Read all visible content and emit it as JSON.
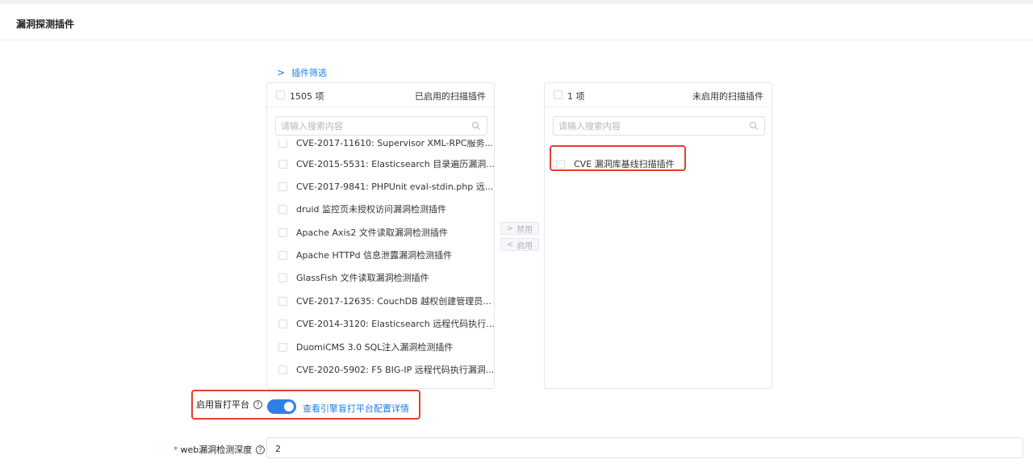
{
  "header": {
    "title": "漏洞探测插件"
  },
  "filter": {
    "label": "插件筛选"
  },
  "left_panel": {
    "count": "1505 项",
    "title": "已启用的扫描插件",
    "search_placeholder": "请输入搜索内容",
    "items": [
      "CVE-2017-11610: Supervisor XML-RPC服务...",
      "CVE-2015-5531: Elasticsearch 目录遍历漏洞...",
      "CVE-2017-9841: PHPUnit eval-stdin.php 远...",
      "druid 监控页未授权访问漏洞检测插件",
      "Apache Axis2 文件读取漏洞检测插件",
      "Apache HTTPd 信息泄露漏洞检测插件",
      "GlassFish 文件读取漏洞检测插件",
      "CVE-2017-12635: CouchDB 越权创建管理员...",
      "CVE-2014-3120: Elasticsearch 远程代码执行...",
      "DuomiCMS 3.0 SQL注入漏洞检测插件",
      "CVE-2020-5902: F5 BIG-IP 远程代码执行漏洞..."
    ]
  },
  "right_panel": {
    "count": "1 项",
    "title": "未启用的扫描插件",
    "search_placeholder": "请输入搜索内容",
    "items": [
      "CVE 漏洞库基线扫描插件"
    ]
  },
  "transfer": {
    "disable_label": "禁用",
    "enable_label": "启用"
  },
  "blind": {
    "label": "启用盲打平台",
    "enabled": true,
    "link": "查看引擎盲打平台配置详情"
  },
  "depth": {
    "label": "web漏洞检测深度",
    "value": "2"
  },
  "colors": {
    "accent": "#1f7fe5",
    "highlight": "#e53e2f"
  }
}
